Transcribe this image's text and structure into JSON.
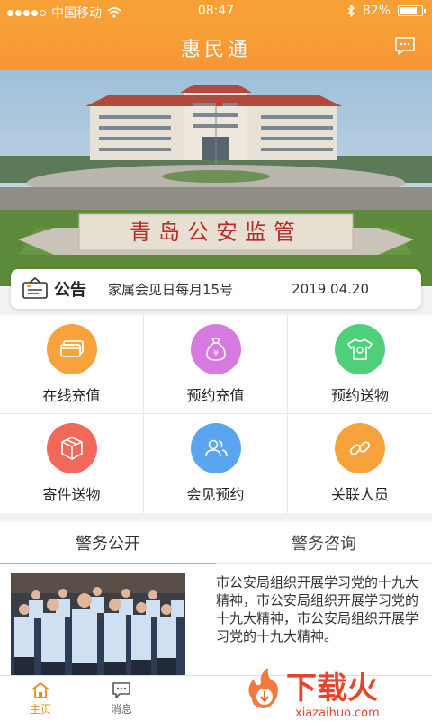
{
  "status_bar": {
    "carrier": "中国移动",
    "time": "08:47",
    "battery": "82%",
    "battery_level": 0.82
  },
  "header": {
    "title": "惠民通",
    "message_icon": "chat-icon"
  },
  "banner": {
    "sign_text": "青岛公安监管"
  },
  "notice": {
    "label": "公告",
    "text": "家属会见日每月15号",
    "date": "2019.04.20"
  },
  "services": [
    {
      "label": "在线充值",
      "icon": "card-icon",
      "color": "#f7a23a"
    },
    {
      "label": "预约充值",
      "icon": "money-bag-icon",
      "color": "#d77ae0"
    },
    {
      "label": "预约送物",
      "icon": "tshirt-icon",
      "color": "#4fcf7a"
    },
    {
      "label": "寄件送物",
      "icon": "package-icon",
      "color": "#f2685a"
    },
    {
      "label": "会见预约",
      "icon": "people-icon",
      "color": "#5aa4f0"
    },
    {
      "label": "关联人员",
      "icon": "link-icon",
      "color": "#f7a23a"
    }
  ],
  "tabs": [
    {
      "label": "警务公开",
      "active": true
    },
    {
      "label": "警务咨询",
      "active": false
    }
  ],
  "news": {
    "text": "市公安局组织开展学习党的十九大精神，市公安局组织开展学习党的十九大精神，市公安局组织开展学习党的十九大精神。"
  },
  "bottom_nav": [
    {
      "label": "主页",
      "icon": "home-icon",
      "active": true
    },
    {
      "label": "消息",
      "icon": "message-icon",
      "active": false
    }
  ],
  "watermark": {
    "brand": "下载火",
    "url": "xiazaihuo.com"
  },
  "colors": {
    "accent": "#f7a035",
    "active_text": "#f08a1a"
  }
}
